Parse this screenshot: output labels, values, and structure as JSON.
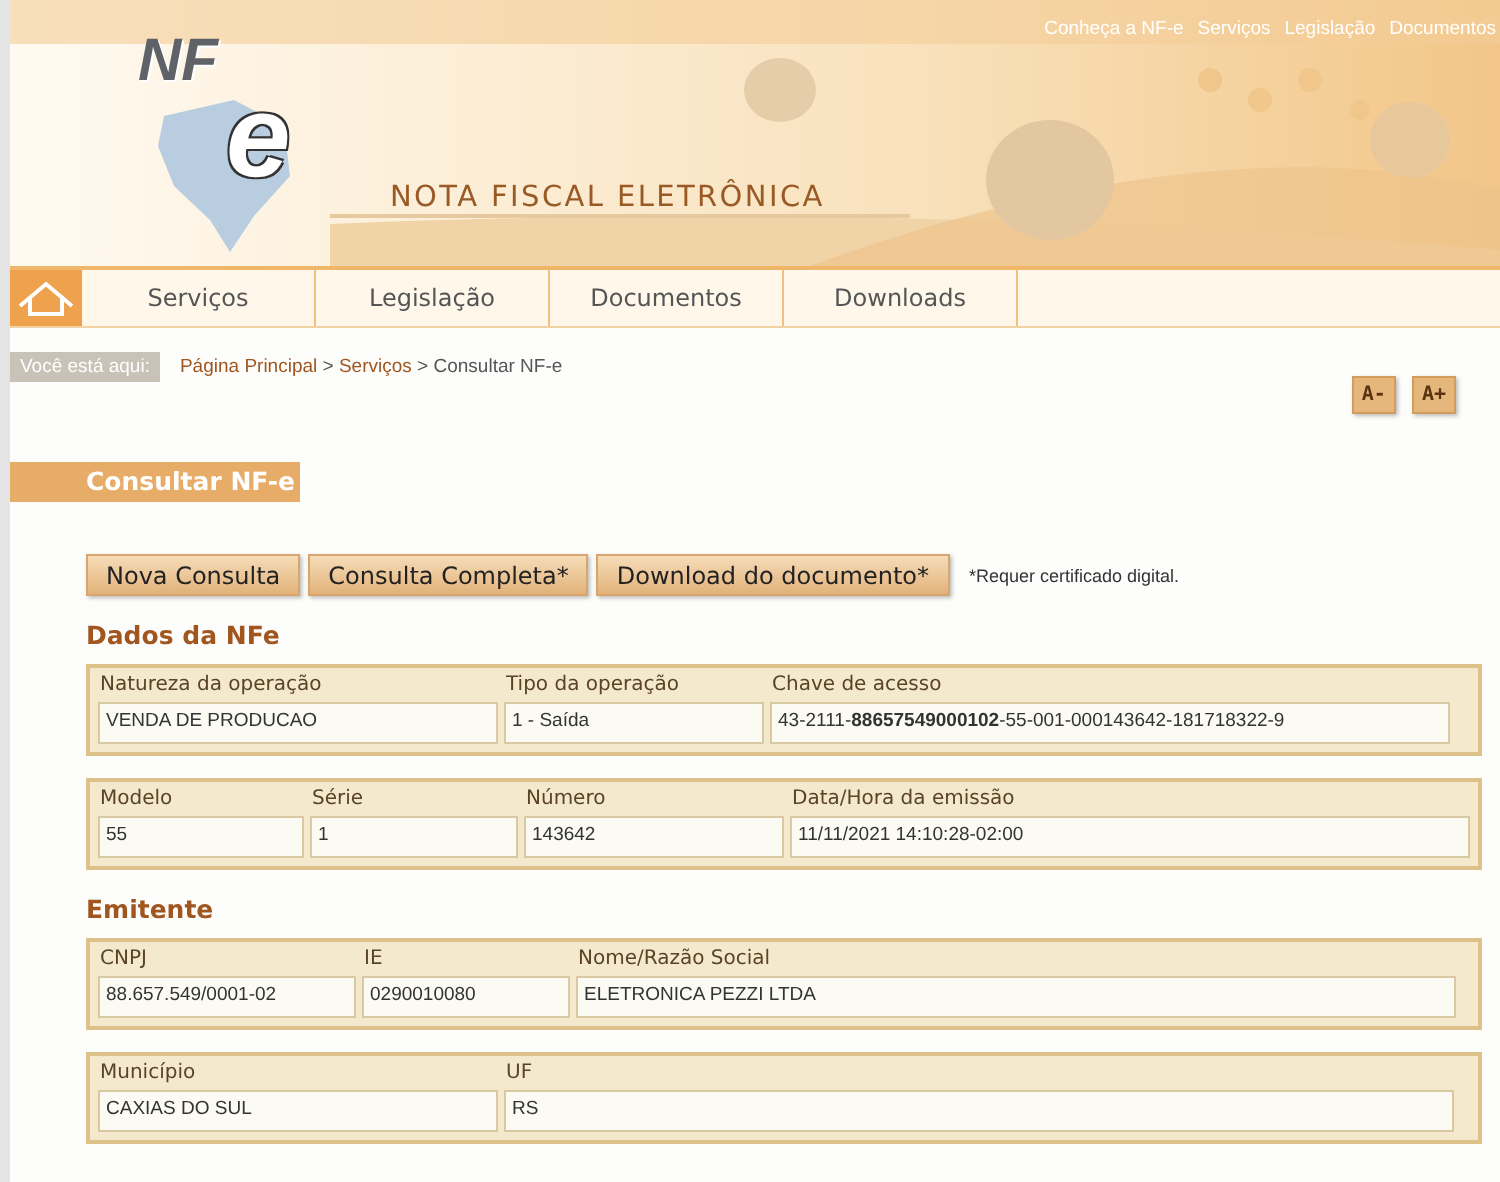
{
  "top_links": [
    "Conheça a NF-e",
    "Serviços",
    "Legislação",
    "Documentos"
  ],
  "logo": {
    "letters": "NF",
    "mark": "e"
  },
  "banner_title": "NOTA FISCAL ELETRÔNICA",
  "nav": [
    {
      "label": "Serviços"
    },
    {
      "label": "Legislação"
    },
    {
      "label": "Documentos"
    },
    {
      "label": "Downloads"
    }
  ],
  "breadcrumb": {
    "label": "Você está aqui:",
    "items": [
      "Página Principal",
      "Serviços"
    ],
    "separator": ">",
    "current": "Consultar NF-e"
  },
  "font_buttons": [
    "A-",
    "A+"
  ],
  "page_title": "Consultar NF-e",
  "actions": [
    "Nova Consulta",
    "Consulta Completa*",
    "Download do documento*"
  ],
  "actions_note": "*Requer certificado digital.",
  "sections": [
    {
      "title": "Dados da NFe",
      "groups": [
        [
          {
            "label": "Natureza da operação",
            "value": "VENDA DE PRODUCAO"
          },
          {
            "label": "Tipo da operação",
            "value": "1 - Saída"
          },
          {
            "label": "Chave de acesso",
            "value": "43-2111-**88657549000102**-55-001-000143642-181718322-9"
          }
        ],
        [
          {
            "label": "Modelo",
            "value": "55"
          },
          {
            "label": "Série",
            "value": "1"
          },
          {
            "label": "Número",
            "value": "143642"
          },
          {
            "label": "Data/Hora da emissão",
            "value": "11/11/2021 14:10:28-02:00"
          }
        ]
      ]
    },
    {
      "title": "Emitente",
      "groups": [
        [
          {
            "label": "CNPJ",
            "value": "88.657.549/0001-02"
          },
          {
            "label": "IE",
            "value": "0290010080"
          },
          {
            "label": "Nome/Razão Social",
            "value": "ELETRONICA PEZZI LTDA"
          }
        ],
        [
          {
            "label": "Município",
            "value": "CAXIAS DO SUL"
          },
          {
            "label": "UF",
            "value": "RS"
          }
        ]
      ]
    }
  ]
}
